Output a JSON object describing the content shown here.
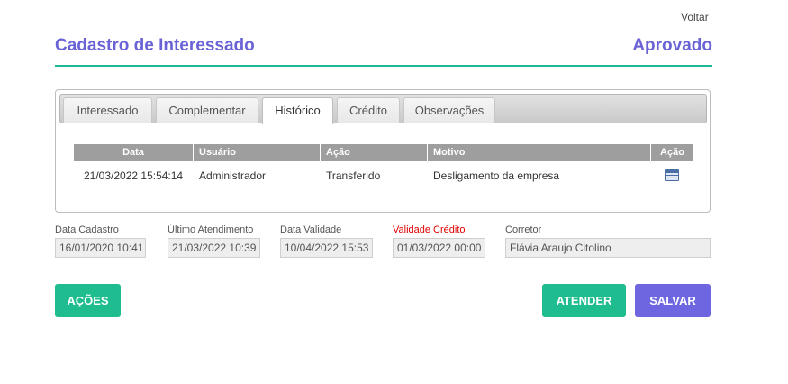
{
  "header": {
    "back_label": "Voltar",
    "title": "Cadastro de Interessado",
    "status": "Aprovado"
  },
  "tabs": [
    {
      "label": "Interessado"
    },
    {
      "label": "Complementar"
    },
    {
      "label": "Histórico",
      "active": true
    },
    {
      "label": "Crédito"
    },
    {
      "label": "Observações"
    }
  ],
  "history": {
    "columns": [
      "Data",
      "Usuário",
      "Ação",
      "Motivo",
      "Ação"
    ],
    "rows": [
      {
        "data": "21/03/2022 15:54:14",
        "usuario": "Administrador",
        "acao": "Transferido",
        "motivo": "Desligamento da empresa",
        "icon": "details-icon"
      }
    ]
  },
  "fields": {
    "data_cadastro": {
      "label": "Data Cadastro",
      "value": "16/01/2020 10:41"
    },
    "ultimo_atendimento": {
      "label": "Último Atendimento",
      "value": "21/03/2022 10:39"
    },
    "data_validade": {
      "label": "Data Validade",
      "value": "10/04/2022 15:53"
    },
    "validade_credito": {
      "label": "Validade Crédito",
      "value": "01/03/2022 00:00"
    },
    "corretor": {
      "label": "Corretor",
      "value": "Flávia Araujo Citolino"
    }
  },
  "actions": {
    "acoes": "AÇÕES",
    "atender": "ATENDER",
    "salvar": "SALVAR"
  },
  "colors": {
    "accent": "#6a63d6",
    "green": "#1ebc8f",
    "purple": "#6d66e0",
    "warning_label": "#e00000"
  }
}
